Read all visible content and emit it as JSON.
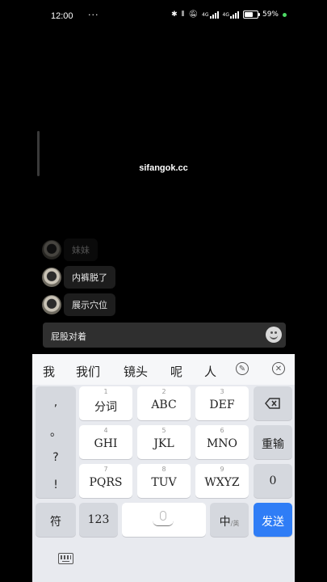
{
  "status_bar": {
    "time": "12:00",
    "more_dots": "···",
    "network_label_1": "4G",
    "network_label_2": "4G",
    "battery_percent": "59%",
    "battery_level": 0.59
  },
  "video": {
    "watermark": "sifangok.cc"
  },
  "comments": [
    {
      "text": "妹妹"
    },
    {
      "text": "内裤脱了"
    },
    {
      "text": "展示穴位"
    }
  ],
  "input": {
    "value": "屁股对着"
  },
  "keyboard": {
    "candidates": [
      "我",
      "我们",
      "镜头",
      "呢",
      "人"
    ],
    "punctuation": [
      ",",
      "。",
      "?",
      "!"
    ],
    "keys": [
      {
        "num": "1",
        "label": "分词"
      },
      {
        "num": "2",
        "label": "ABC"
      },
      {
        "num": "3",
        "label": "DEF"
      },
      {
        "num": "4",
        "label": "GHI"
      },
      {
        "num": "5",
        "label": "JKL"
      },
      {
        "num": "6",
        "label": "MNO"
      },
      {
        "num": "7",
        "label": "PQRS"
      },
      {
        "num": "8",
        "label": "TUV"
      },
      {
        "num": "9",
        "label": "WXYZ"
      }
    ],
    "retype_label": "重输",
    "zero_label": "0",
    "symbol_label": "符",
    "numbers_label": "123",
    "lang_label": "中",
    "lang_sub": "/英",
    "send_label": "发送"
  }
}
